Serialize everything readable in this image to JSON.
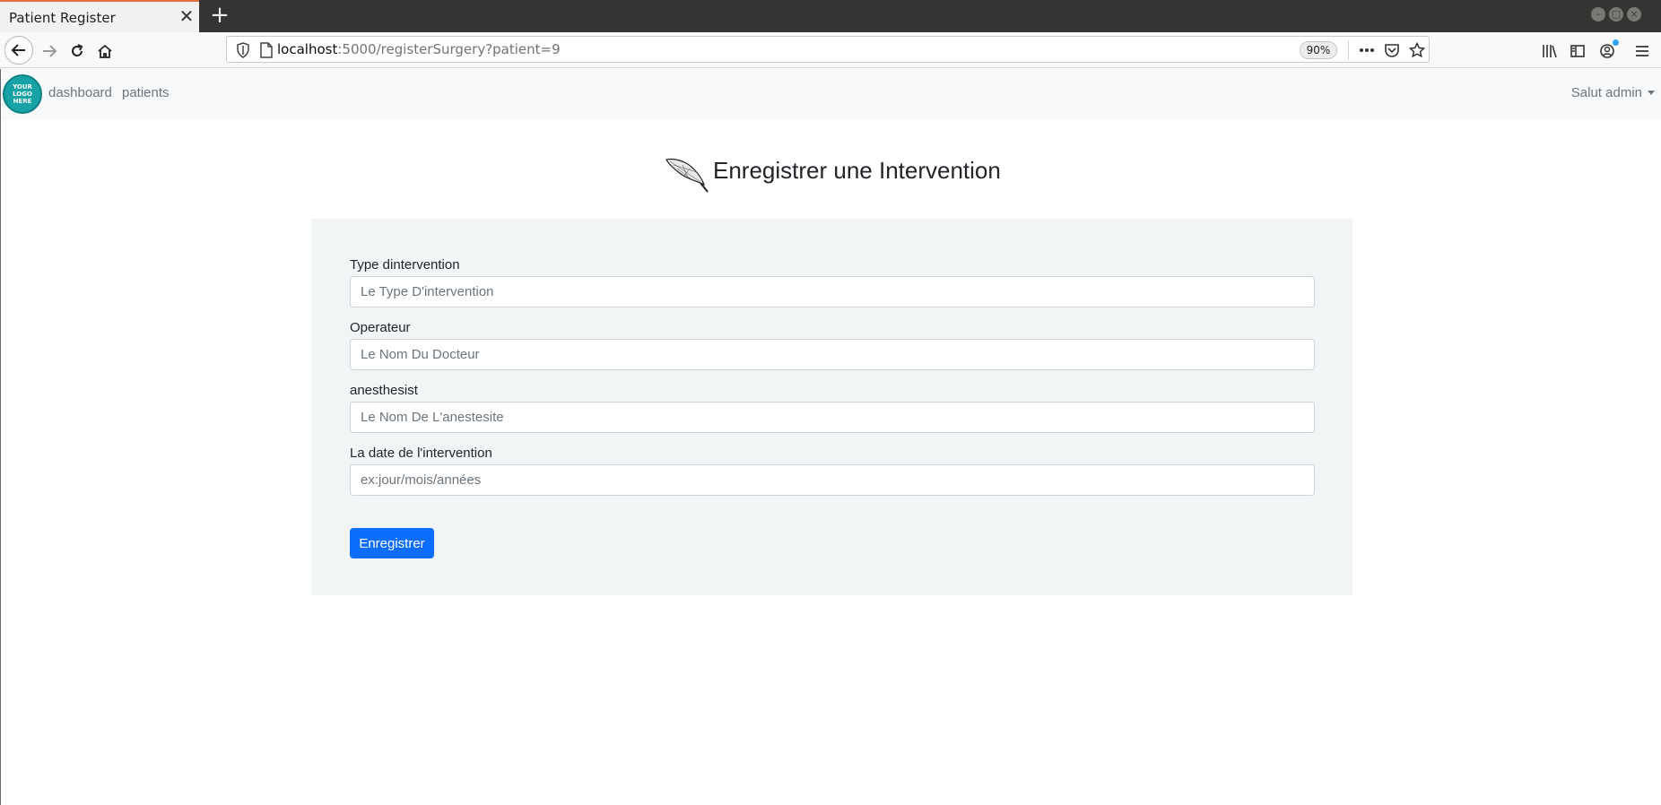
{
  "browser": {
    "tab_title": "Patient Register",
    "tab_close": "✕",
    "new_tab": "+",
    "url_host": "localhost",
    "url_rest": ":5000/registerSurgery?patient=9",
    "zoom": "90%"
  },
  "navbar": {
    "logo_text": "YOUR LOGO HERE",
    "links": [
      "dashboard",
      "patients"
    ],
    "user_menu": "Salut admin"
  },
  "main": {
    "title": "Enregistrer une Intervention",
    "fields": [
      {
        "label": "Type dintervention",
        "placeholder": "Le Type D'intervention",
        "value": ""
      },
      {
        "label": "Operateur",
        "placeholder": "Le Nom Du Docteur",
        "value": ""
      },
      {
        "label": "anesthesist",
        "placeholder": "Le Nom De L'anestesite",
        "value": ""
      },
      {
        "label": "La date de l'intervention",
        "placeholder": "ex:jour/mois/années",
        "value": ""
      }
    ],
    "submit_label": "Enregistrer"
  },
  "icons": {
    "back": "arrow-left-icon",
    "forward": "arrow-right-icon",
    "reload": "reload-icon",
    "home": "home-icon",
    "shield": "tracking-shield-icon",
    "page": "page-icon",
    "more": "more-icon",
    "pocket": "pocket-icon",
    "bookmark": "star-icon",
    "library": "library-icon",
    "sidebar": "sidebar-icon",
    "account": "account-icon",
    "menu": "hamburger-menu-icon",
    "title_image": "scalpel-icon"
  },
  "colors": {
    "accent_button": "#0d6efd",
    "logo": "#17a2a6",
    "tab_accent": "#e66e3c"
  }
}
